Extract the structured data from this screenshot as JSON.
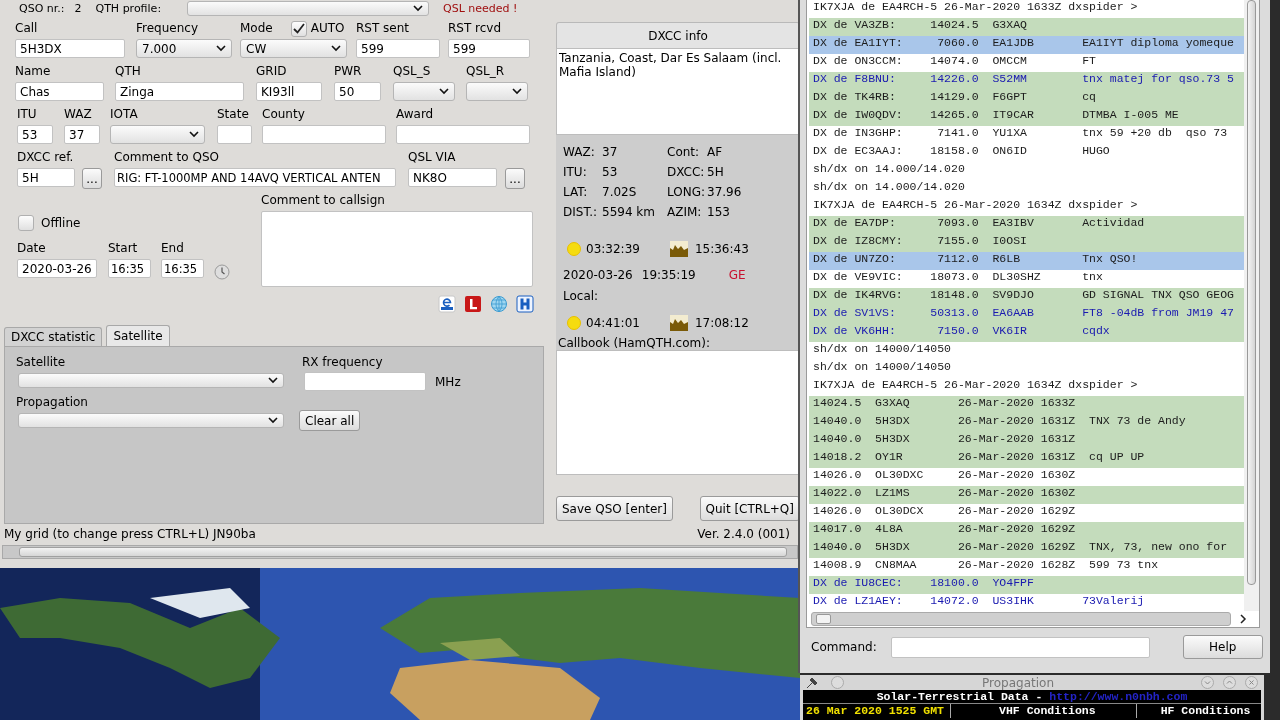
{
  "top_bar": {
    "qso_nr_label": "QSO nr.:",
    "qso_nr": "2",
    "qth_profile_label": "QTH profile:",
    "qsl_needed": "QSL needed !"
  },
  "qso_form": {
    "fields": [
      {
        "label": "Call",
        "kind": "text",
        "value": "5H3DX"
      },
      {
        "label": "Frequency",
        "kind": "select",
        "value": "7.000"
      },
      {
        "label": "Mode",
        "kind": "select",
        "value": "CW",
        "auto": {
          "label": "AUTO",
          "checked": true
        }
      },
      {
        "label": "RST sent",
        "kind": "text",
        "value": "599"
      },
      {
        "label": "RST rcvd",
        "kind": "text",
        "value": "599"
      },
      {
        "label": "Name",
        "kind": "text",
        "value": "Chas"
      },
      {
        "label": "QTH",
        "kind": "text",
        "value": "Zinga"
      },
      {
        "label": "GRID",
        "kind": "text",
        "value": "KI93ll"
      },
      {
        "label": "PWR",
        "kind": "text",
        "value": "50"
      },
      {
        "label": "QSL_S",
        "kind": "select"
      },
      {
        "label": "QSL_R",
        "kind": "select"
      },
      {
        "label": "ITU",
        "kind": "text",
        "value": "53"
      },
      {
        "label": "WAZ",
        "kind": "text",
        "value": "37"
      },
      {
        "label": "IOTA",
        "kind": "select"
      },
      {
        "label": "State",
        "kind": "text"
      },
      {
        "label": "County",
        "kind": "text"
      },
      {
        "label": "Award",
        "kind": "text"
      },
      {
        "label": "DXCC ref.",
        "kind": "text",
        "value": "5H"
      },
      {
        "kind": "button",
        "text": "..."
      },
      {
        "label": "Comment to QSO",
        "kind": "text",
        "value": "RIG: FT-1000MP AND 14AVQ VERTICAL ANTEN"
      },
      {
        "label": "QSL VIA",
        "kind": "text",
        "value": "NK8O"
      },
      {
        "kind": "button",
        "text": "..."
      }
    ]
  },
  "lower": {
    "offline": {
      "label": "Offline",
      "checked": false
    },
    "times": [
      {
        "label": "Date",
        "value": "2020-03-26"
      },
      {
        "label": "Start",
        "value": "16:35"
      },
      {
        "label": "End",
        "value": "16:35"
      }
    ],
    "comment_label": "Comment to callsign"
  },
  "tabs": [
    {
      "label": "DXCC statistic",
      "selected": false
    },
    {
      "label": "Satellite",
      "selected": true
    }
  ],
  "satellite_panel": {
    "satellite_label": "Satellite",
    "rx_label": "RX frequency",
    "rx_unit": "MHz",
    "propagation_label": "Propagation",
    "clear_button": "Clear all"
  },
  "dxcc_info": {
    "title": "DXCC info",
    "country": "Tanzania, Coast, Dar Es Salaam (incl. Mafia Island)",
    "stats": [
      {
        "label": "WAZ:",
        "value": "37"
      },
      {
        "label": "Cont:",
        "value": "AF"
      },
      {
        "label": "ITU:",
        "value": "53"
      },
      {
        "label": "DXCC:",
        "value": "5H"
      },
      {
        "label": "LAT:",
        "value": "7.02S"
      },
      {
        "label": "LONG:",
        "value": "37.96"
      },
      {
        "label": "DIST.:",
        "value": "5594 km"
      },
      {
        "label": "AZIM:",
        "value": "153"
      }
    ],
    "sun_times": [
      {
        "kind": "sunrise",
        "time": "03:32:39"
      },
      {
        "kind": "sunset",
        "time": "15:36:43"
      }
    ],
    "date": "2020-03-26",
    "time": "19:35:19",
    "greyline": "GE",
    "local_label": "Local:",
    "local_sun_times": [
      {
        "kind": "sunrise",
        "time": "04:41:01"
      },
      {
        "kind": "sunset",
        "time": "17:08:12"
      }
    ],
    "callbook_label": "Callbook (HamQTH.com):"
  },
  "buttons": [
    "Save QSO [enter]",
    "Quit [CTRL+Q]"
  ],
  "status_bar": {
    "grid": "My grid (to change press CTRL+L) JN90ba",
    "version": "Ver. 2.4.0 (001)"
  },
  "dx_cluster": {
    "lines": [
      {
        "text": "IK7XJA de EA4RCH-5 26-Mar-2020 1633Z dxspider >",
        "kind": "plain",
        "color": "#ffffff"
      },
      {
        "text": "DX de VA3ZB:     14024.5  G3XAQ",
        "kind": "plain",
        "color": "#c4dcbc"
      },
      {
        "text": "DX de EA1IYT:     7060.0  EA1JDB       EA1IYT diploma yomeque",
        "kind": "plain",
        "color": "#a9c6ea"
      },
      {
        "text": "DX de ON3CCM:    14074.0  OMCCM        FT",
        "kind": "plain",
        "color": "#ffffff"
      },
      {
        "text": "DX de F8BNU:     14226.0  S52MM        tnx matej for qso.73 5",
        "kind": "marked",
        "color": "#c4dcbc"
      },
      {
        "text": "DX de TK4RB:     14129.0  F6GPT        cq",
        "kind": "plain",
        "color": "#c4dcbc"
      },
      {
        "text": "DX de IW0QDV:    14265.0  IT9CAR       DTMBA I-005 ME",
        "kind": "plain",
        "color": "#c4dcbc"
      },
      {
        "text": "DX de IN3GHP:     7141.0  YU1XA        tnx 59 +20 db  qso 73",
        "kind": "plain",
        "color": "#ffffff"
      },
      {
        "text": "DX de EC3AAJ:    18158.0  ON6ID        HUGO",
        "kind": "plain",
        "color": "#ffffff"
      },
      {
        "text": "sh/dx on 14.000/14.020",
        "kind": "plain",
        "color": "#ffffff"
      },
      {
        "text": "sh/dx on 14.000/14.020",
        "kind": "plain",
        "color": "#ffffff"
      },
      {
        "text": "IK7XJA de EA4RCH-5 26-Mar-2020 1634Z dxspider >",
        "kind": "plain",
        "color": "#ffffff"
      },
      {
        "text": "DX de EA7DP:      7093.0  EA3IBV       Actividad",
        "kind": "plain",
        "color": "#c4dcbc"
      },
      {
        "text": "DX de IZ8CMY:     7155.0  I0OSI",
        "kind": "plain",
        "color": "#c4dcbc"
      },
      {
        "text": "DX de UN7ZO:      7112.0  R6LB         Tnx QSO!",
        "kind": "plain",
        "color": "#a9c6ea"
      },
      {
        "text": "DX de VE9VIC:    18073.0  DL30SHZ      tnx",
        "kind": "plain",
        "color": "#ffffff"
      },
      {
        "text": "DX de IK4RVG:    18148.0  SV9DJO       GD SIGNAL TNX QSO GEOG",
        "kind": "plain",
        "color": "#c4dcbc"
      },
      {
        "text": "DX de SV1VS:     50313.0  EA6AAB       FT8 -04dB from JM19 47",
        "kind": "marked",
        "color": "#c4dcbc"
      },
      {
        "text": "DX de VK6HH:      7150.0  VK6IR        cqdx",
        "kind": "marked",
        "color": "#c4dcbc"
      },
      {
        "text": "sh/dx on 14000/14050",
        "kind": "plain",
        "color": "#ffffff"
      },
      {
        "text": "sh/dx on 14000/14050",
        "kind": "plain",
        "color": "#ffffff"
      },
      {
        "text": "IK7XJA de EA4RCH-5 26-Mar-2020 1634Z dxspider >",
        "kind": "plain",
        "color": "#ffffff"
      },
      {
        "text": "14024.5  G3XAQ       26-Mar-2020 1633Z",
        "kind": "plain",
        "color": "#c4dcbc"
      },
      {
        "text": "14040.0  5H3DX       26-Mar-2020 1631Z  TNX 73 de Andy",
        "kind": "plain",
        "color": "#c4dcbc"
      },
      {
        "text": "14040.0  5H3DX       26-Mar-2020 1631Z",
        "kind": "plain",
        "color": "#c4dcbc"
      },
      {
        "text": "14018.2  OY1R        26-Mar-2020 1631Z  cq UP UP",
        "kind": "plain",
        "color": "#c4dcbc"
      },
      {
        "text": "14026.0  OL30DXC     26-Mar-2020 1630Z",
        "kind": "plain",
        "color": "#ffffff"
      },
      {
        "text": "14022.0  LZ1MS       26-Mar-2020 1630Z",
        "kind": "plain",
        "color": "#c4dcbc"
      },
      {
        "text": "14026.0  OL30DCX     26-Mar-2020 1629Z",
        "kind": "plain",
        "color": "#ffffff"
      },
      {
        "text": "14017.0  4L8A        26-Mar-2020 1629Z",
        "kind": "plain",
        "color": "#c4dcbc"
      },
      {
        "text": "14040.0  5H3DX       26-Mar-2020 1629Z  TNX, 73, new ono for",
        "kind": "plain",
        "color": "#c4dcbc"
      },
      {
        "text": "14008.9  CN8MAA      26-Mar-2020 1628Z  599 73 tnx",
        "kind": "plain",
        "color": "#ffffff"
      },
      {
        "text": "DX de IU8CEC:    18100.0  YO4FPF",
        "kind": "marked",
        "color": "#c4dcbc"
      },
      {
        "text": "DX de LZ1AEY:    14072.0  US3IHK       73Valerij",
        "kind": "marked",
        "color": "#ffffff"
      }
    ],
    "command_label": "Command:",
    "help_button": "Help"
  },
  "propagation": {
    "title": "Propagation",
    "heading": "Solar-Terrestrial Data -",
    "link": "http://www.n0nbh.com",
    "date": "26 Mar 2020 1525 GMT",
    "vhf": "VHF Conditions",
    "hf": "HF Conditions"
  }
}
